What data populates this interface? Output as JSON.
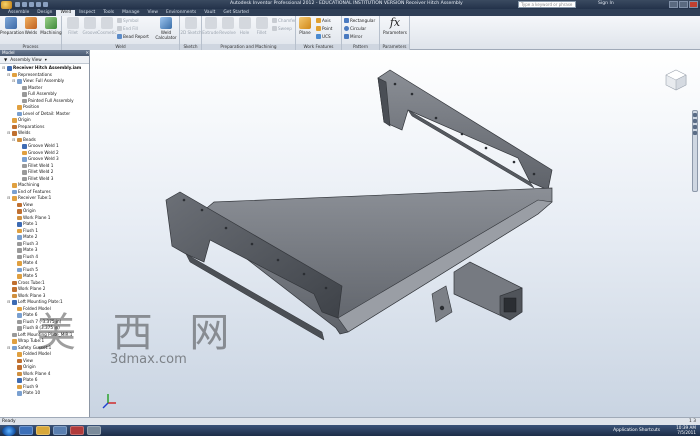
{
  "window": {
    "title": "Autodesk Inventor Professional 2012 - EDUCATIONAL INSTITUTION VERSION   Receiver Hitch Assembly",
    "search_placeholder": "Type a keyword or phrase",
    "sign_in": "Sign In"
  },
  "tabs": [
    "Assemble",
    "Design",
    "Weld",
    "Inspect",
    "Tools",
    "Manage",
    "View",
    "Environments",
    "Vault",
    "Get Started"
  ],
  "active_tab": "Weld",
  "ribbon": {
    "process": {
      "label": "Process",
      "buttons": [
        "Preparation",
        "Welds",
        "Machining"
      ]
    },
    "weld": {
      "label": "Weld",
      "buttons": [
        "Fillet",
        "Groove",
        "Cosmetic"
      ],
      "small": [
        "Symbol",
        "End Fill",
        "Bead Report"
      ],
      "calc": "Weld Calculator"
    },
    "sketch": {
      "label": "Sketch",
      "buttons": [
        "2D Sketch"
      ]
    },
    "prep": {
      "label": "Preparation and Machining",
      "buttons": [
        "Extrude",
        "Revolve",
        "Hole",
        "Fillet"
      ],
      "small": [
        "Chamfer",
        "Sweep"
      ]
    },
    "work": {
      "label": "Work Features",
      "plane": "Plane",
      "small": [
        "Axis",
        "Point",
        "UCS"
      ]
    },
    "pattern": {
      "label": "Pattern",
      "small": [
        "Rectangular",
        "Circular",
        "Mirror"
      ]
    },
    "params": {
      "label": "Parameters",
      "buttons": [
        "Parameters"
      ]
    }
  },
  "browser": {
    "header": "Model",
    "view_label": "Assembly View",
    "items": [
      "Receiver Hitch Assembly.iam",
      "Representations",
      "View: Full Assembly",
      "Master",
      "Full Assembly",
      "Painted Full Assembly",
      "Position",
      "Level of Detail: Master",
      "Origin",
      "Preparations",
      "Welds",
      "Beads",
      "Groove Weld 1",
      "Groove Weld 2",
      "Groove Weld 3",
      "Fillet Weld 1",
      "Fillet Weld 2",
      "Fillet Weld 3",
      "Machining",
      "End of Features",
      "Receiver Tube:1",
      "View",
      "Origin",
      "Work Plane 1",
      "Plate 1",
      "Flush 1",
      "Mate 2",
      "Flush 3",
      "Mate 3",
      "Flush 4",
      "Mate 4",
      "Flush 5",
      "Mate 5",
      "Cross Tube:1",
      "Work Plane 2",
      "Work Plane 3",
      "Left Mounting Plate:1",
      "Folded Model",
      "Plate 6",
      "Flush 7 (-3.375 in)",
      "Flush 8 (3.375 in)",
      "Left Mounting Plate_MIR:1",
      "Wrap Tube:1",
      "Safety Gusset:1",
      "Folded Model",
      "View",
      "Origin",
      "Work Plane 4",
      "Plate 6",
      "Flush 9",
      "Plate 10"
    ]
  },
  "status": {
    "left": "Ready",
    "right": "1   3"
  },
  "taskbar": {
    "tray_label": "Application Shortcuts",
    "time": "10:39 AM",
    "date": "7/5/2011"
  },
  "watermark": {
    "text": "美 西 网",
    "sub": "3dmax.com"
  },
  "colors": {
    "accent": "#2f3f56",
    "model": "#6e7279",
    "viewport_top": "#ffffff",
    "viewport_bottom": "#c9d4e2"
  }
}
